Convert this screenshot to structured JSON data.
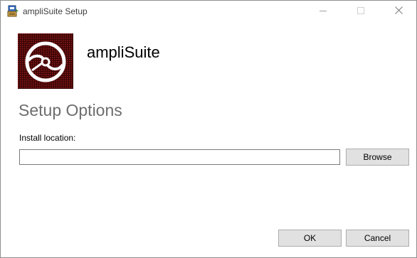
{
  "window": {
    "title": "ampliSuite Setup",
    "controls": {
      "minimize_icon": "minimize-icon",
      "maximize_icon": "maximize-icon",
      "close_icon": "close-icon"
    }
  },
  "header": {
    "product_name": "ampliSuite",
    "logo_icon": "disc-icon"
  },
  "main": {
    "section_title": "Setup Options",
    "install_location": {
      "label": "Install location:",
      "value": "",
      "placeholder": ""
    },
    "browse_label": "Browse"
  },
  "footer": {
    "ok_label": "OK",
    "cancel_label": "Cancel"
  },
  "colors": {
    "logo_background": "#5a0a0a",
    "section_title": "#6d6d6d",
    "button_face": "#e1e1e1",
    "button_border": "#adadad"
  }
}
